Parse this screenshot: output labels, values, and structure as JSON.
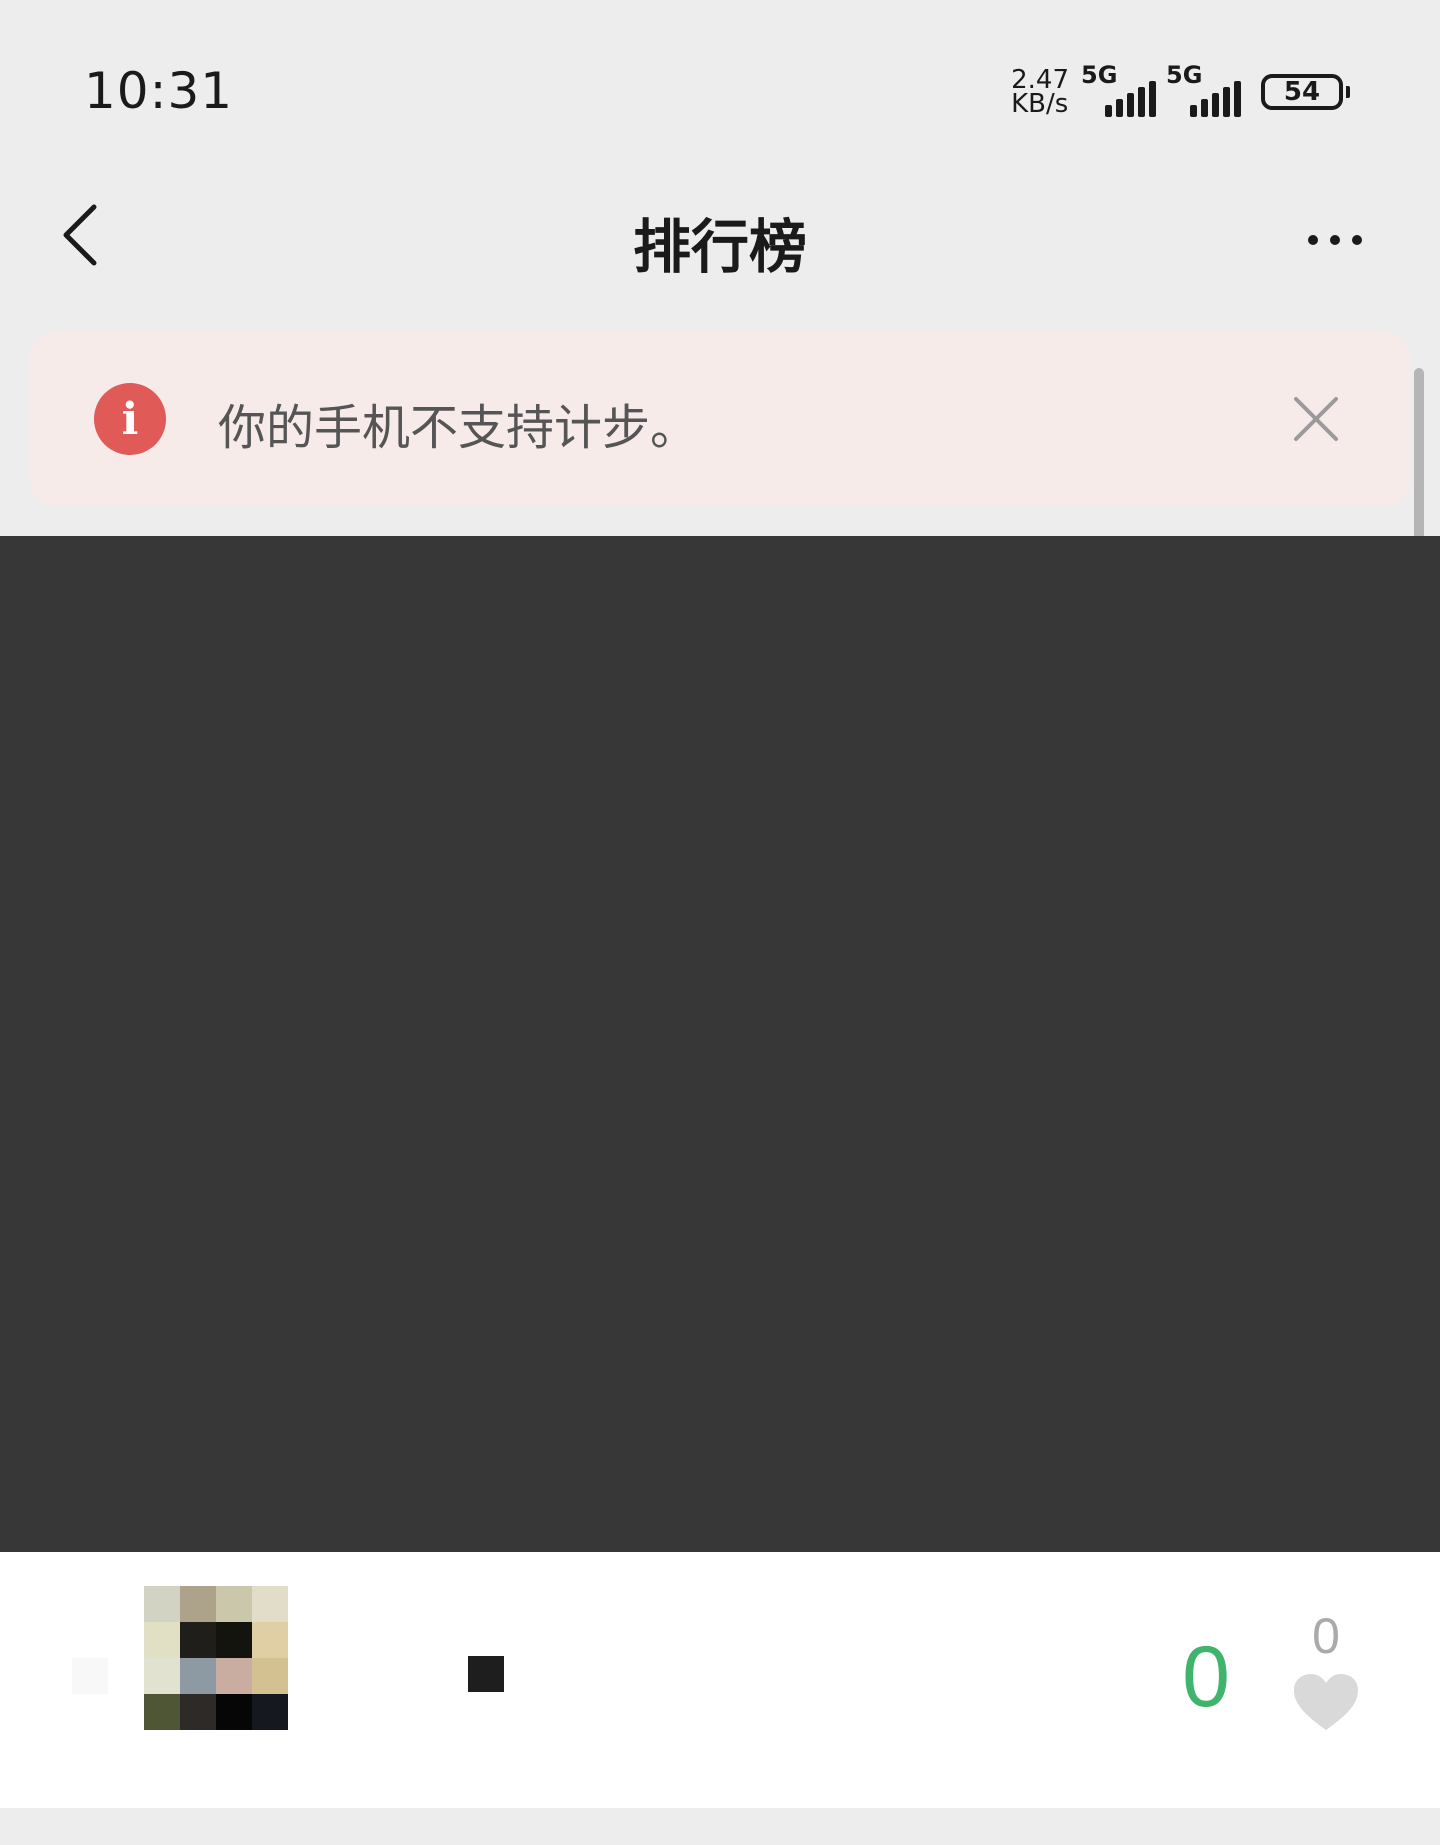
{
  "status_bar": {
    "time": "10:31",
    "net_speed_value": "2.47",
    "net_speed_unit": "KB/s",
    "sim1_label": "5G",
    "sim2_label": "5G",
    "battery_level": "54",
    "sim1_signal_icon": "signal-bars-icon",
    "sim2_signal_icon": "signal-bars-icon",
    "battery_icon": "battery-icon"
  },
  "nav": {
    "title": "排行榜",
    "back_icon": "chevron-left-icon",
    "more_icon": "more-dots-icon"
  },
  "warning": {
    "icon": "info-icon",
    "icon_glyph": "i",
    "message": "你的手机不支持计步。",
    "close_icon": "close-icon",
    "accent_color": "#e05a57",
    "background_color": "#f7ebea"
  },
  "cover": {
    "background_color": "#373737"
  },
  "ranking": {
    "entries": [
      {
        "steps": "0",
        "likes": "0",
        "like_icon": "heart-icon",
        "steps_color": "#3eb46c"
      }
    ]
  }
}
